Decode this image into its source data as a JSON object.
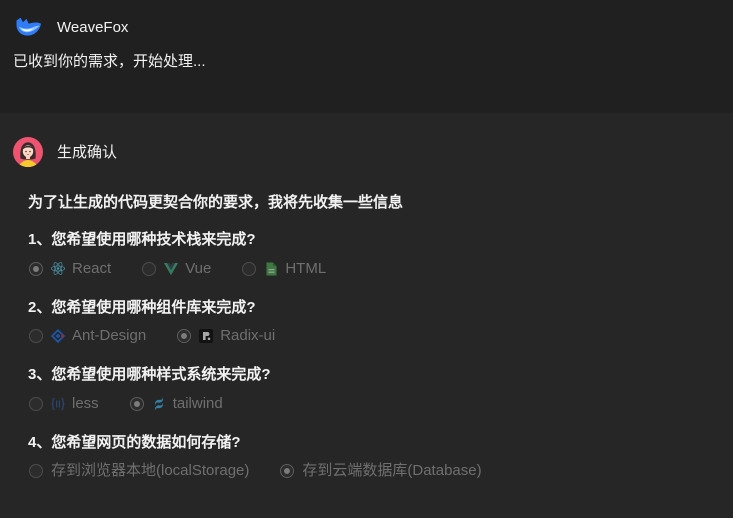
{
  "colors": {
    "header_bg": "#202020",
    "panel_bg": "#262626",
    "text": "#f2f2f2",
    "option_text": "#6f6f6f",
    "radio_border": "#4c4c4c",
    "radio_dot": "#7b7b7b"
  },
  "header": {
    "logo_icon": "weavefox-logo-icon",
    "app_name": "WeaveFox"
  },
  "status_message": "已收到你的需求，开始处理...",
  "confirm": {
    "avatar_icon": "user-avatar-icon",
    "title": "生成确认",
    "intro": "为了让生成的代码更契合你的要求，我将先收集一些信息",
    "disabled": true,
    "questions": [
      {
        "label": "1、您希望使用哪种技术栈来完成?",
        "options": [
          {
            "label": "React",
            "icon": "react-icon",
            "selected": true
          },
          {
            "label": "Vue",
            "icon": "vue-icon",
            "selected": false
          },
          {
            "label": "HTML",
            "icon": "html-file-icon",
            "selected": false
          }
        ]
      },
      {
        "label": "2、您希望使用哪种组件库来完成?",
        "options": [
          {
            "label": "Ant-Design",
            "icon": "ant-design-icon",
            "selected": false
          },
          {
            "label": "Radix-ui",
            "icon": "radix-ui-icon",
            "selected": true
          }
        ]
      },
      {
        "label": "3、您希望使用哪种样式系统来完成?",
        "options": [
          {
            "label": "less",
            "icon": "less-icon",
            "selected": false
          },
          {
            "label": "tailwind",
            "icon": "tailwind-icon",
            "selected": true
          }
        ]
      },
      {
        "label": "4、您希望网页的数据如何存储?",
        "options": [
          {
            "label": "存到浏览器本地(localStorage)",
            "selected": false
          },
          {
            "label": "存到云端数据库(Database)",
            "selected": true
          }
        ]
      }
    ]
  }
}
